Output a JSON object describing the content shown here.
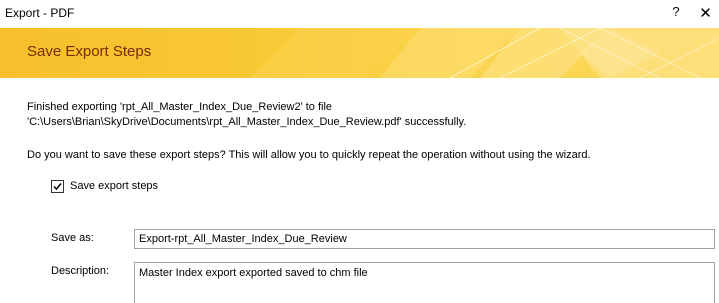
{
  "window": {
    "title": "Export - PDF",
    "help_glyph": "?",
    "close_glyph": "✕"
  },
  "banner": {
    "heading": "Save Export Steps",
    "colors": {
      "base": "#f6c02c",
      "heading_text": "#7a2a06"
    }
  },
  "main": {
    "finished_message": "Finished exporting 'rpt_All_Master_Index_Due_Review2' to file 'C:\\Users\\Brian\\SkyDrive\\Documents\\rpt_All_Master_Index_Due_Review.pdf' successfully.",
    "question": "Do you want to save these export steps? This will allow you to quickly repeat the operation without using the wizard.",
    "save_steps": {
      "label": "Save export steps",
      "checked": true
    },
    "save_as": {
      "label": "Save as:",
      "value": "Export-rpt_All_Master_Index_Due_Review"
    },
    "description": {
      "label": "Description:",
      "value": "Master Index export exported saved to chm file "
    }
  }
}
